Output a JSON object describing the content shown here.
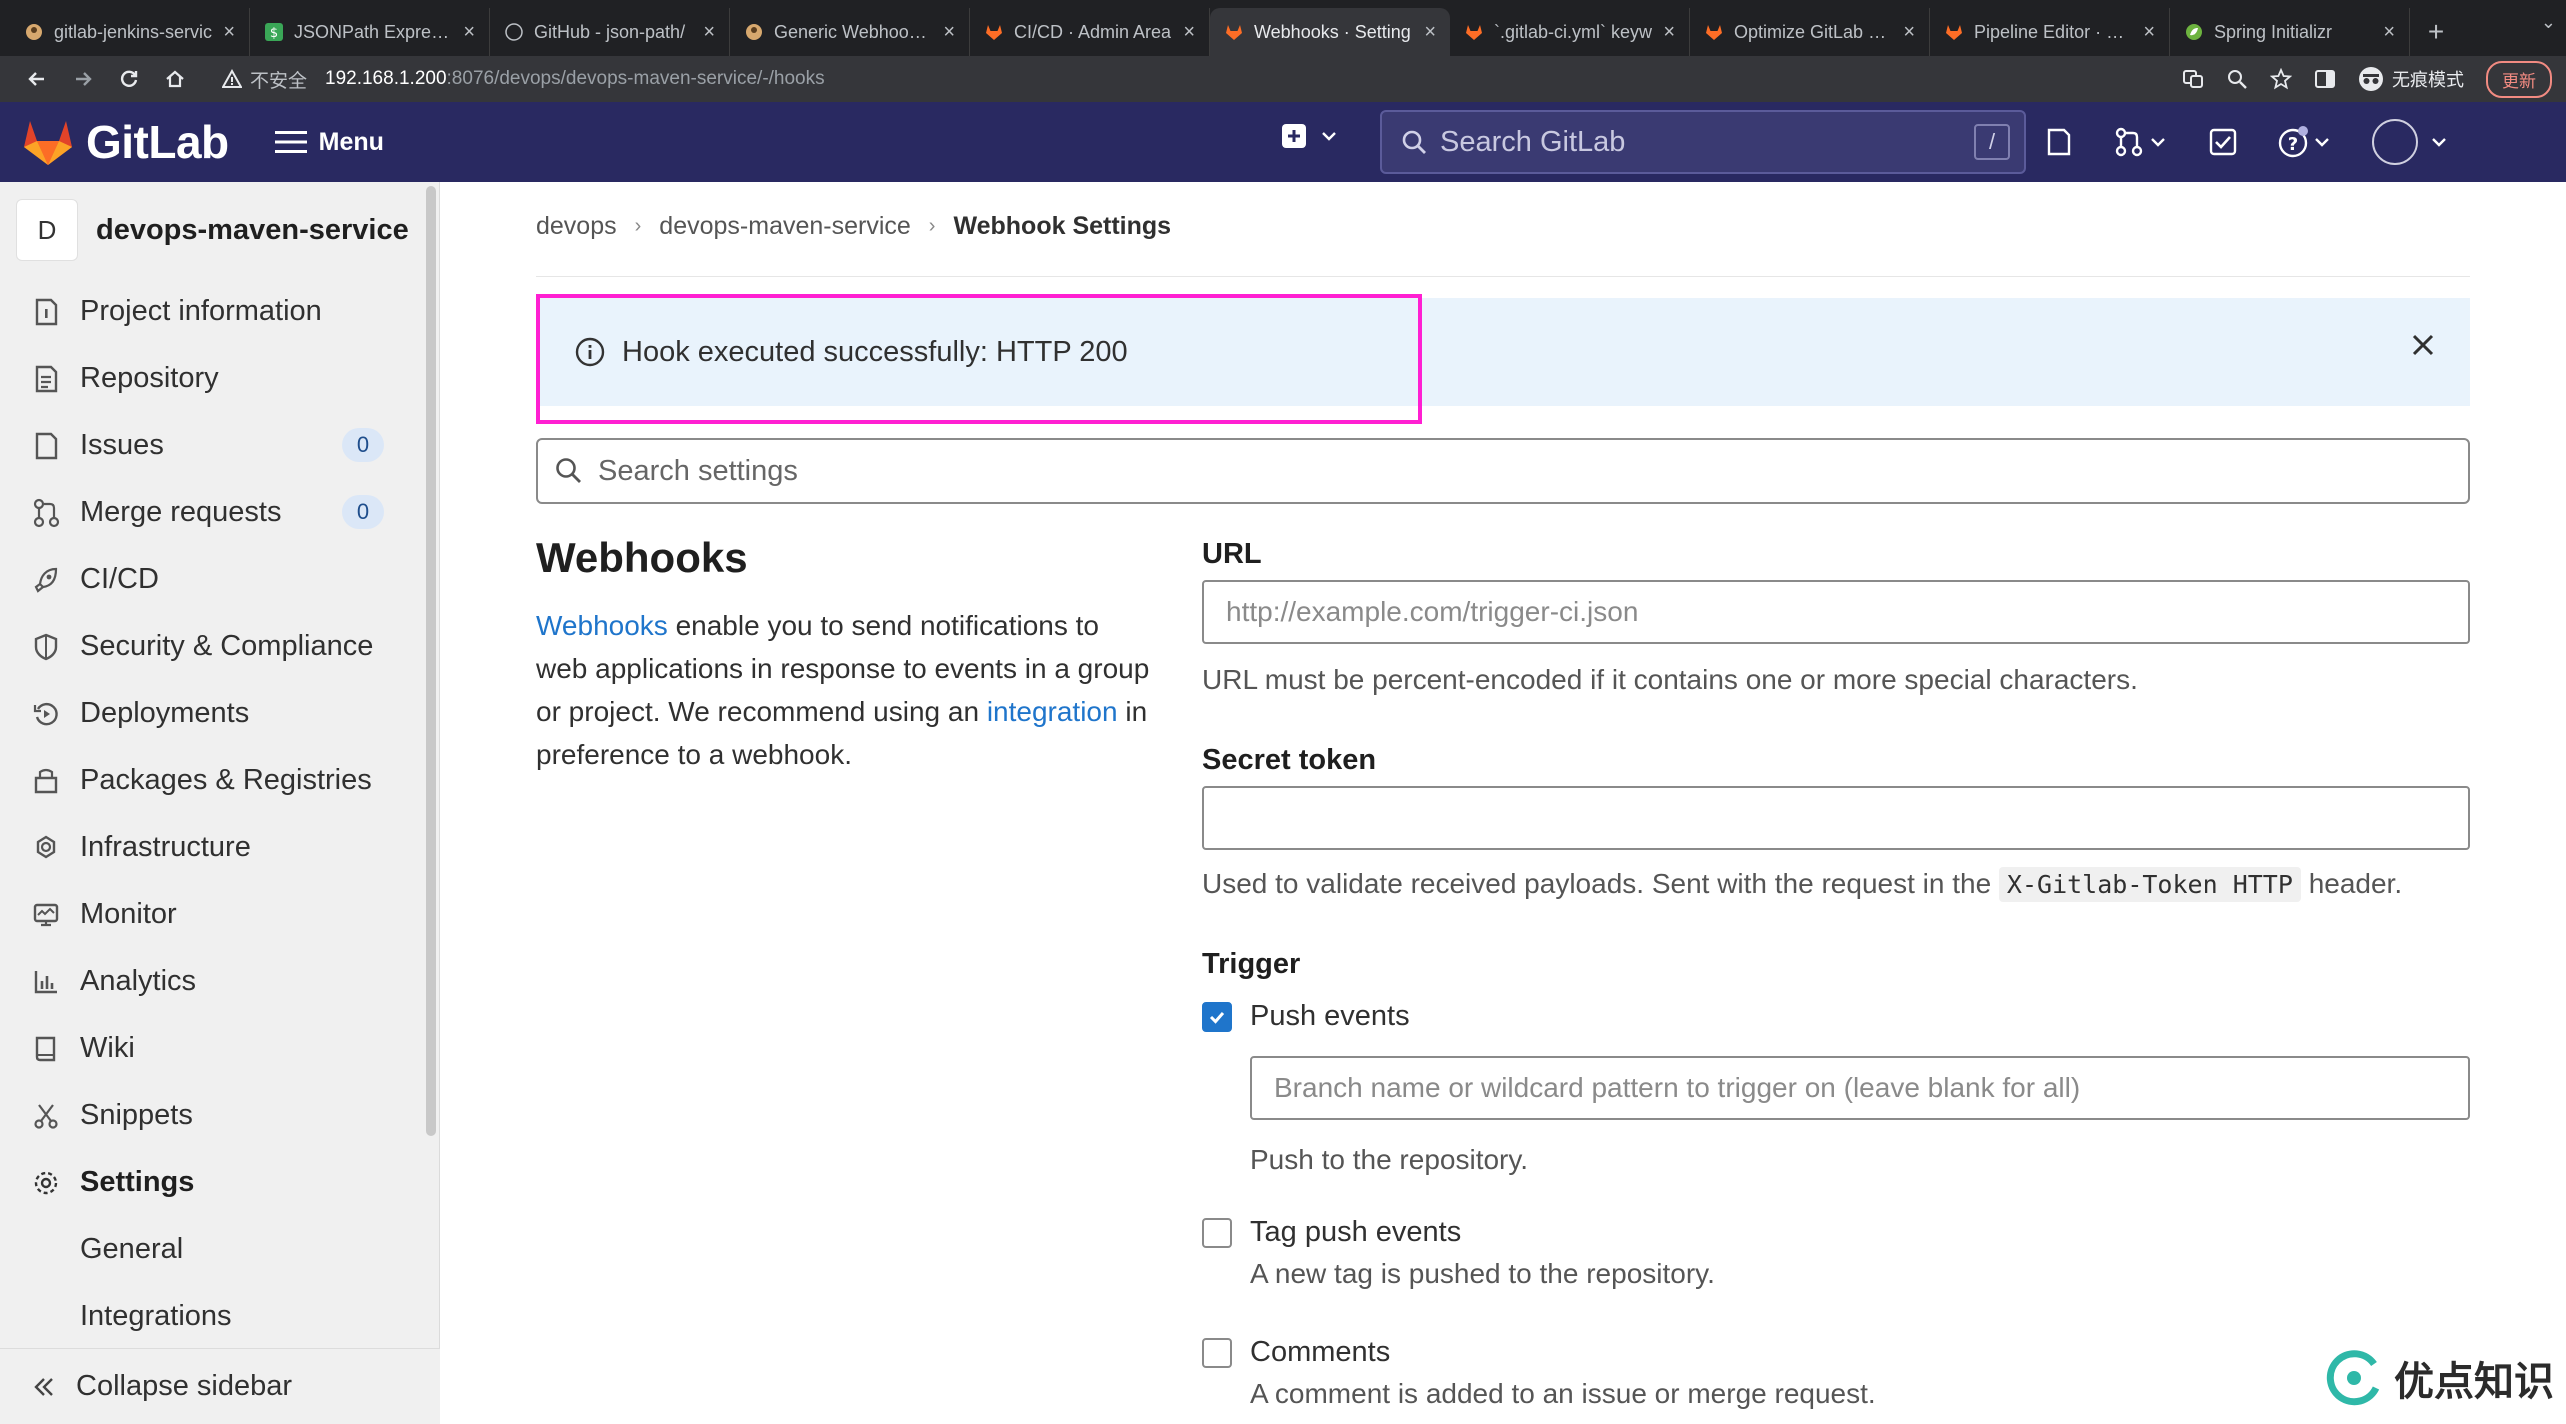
{
  "browser": {
    "tabs": [
      {
        "title": "gitlab-jenkins-servic",
        "active": false,
        "favicon": "bot-icon"
      },
      {
        "title": "JSONPath Expressio",
        "active": false,
        "favicon": "dollar-icon"
      },
      {
        "title": "GitHub - json-path/",
        "active": false,
        "favicon": "github-icon"
      },
      {
        "title": "Generic Webhook Tr",
        "active": false,
        "favicon": "bot-icon"
      },
      {
        "title": "CI/CD · Admin Area",
        "active": false,
        "favicon": "gitlab-icon"
      },
      {
        "title": "Webhooks · Setting",
        "active": true,
        "favicon": "gitlab-icon"
      },
      {
        "title": "`.gitlab-ci.yml` keyw",
        "active": false,
        "favicon": "gitlab-icon"
      },
      {
        "title": "Optimize GitLab CI/C",
        "active": false,
        "favicon": "gitlab-icon"
      },
      {
        "title": "Pipeline Editor · dev",
        "active": false,
        "favicon": "gitlab-icon"
      },
      {
        "title": "Spring Initializr",
        "active": false,
        "favicon": "spring-icon"
      }
    ],
    "tab_close": "×",
    "new_tab": "+",
    "insecure_label": "不安全",
    "url_host": "192.168.1.200",
    "url_path": ":8076/devops/devops-maven-service/-/hooks",
    "incognito_label": "无痕模式",
    "update_label": "更新"
  },
  "header": {
    "logo_text": "GitLab",
    "menu_label": "Menu",
    "search_placeholder": "Search GitLab",
    "search_shortcut": "/"
  },
  "sidebar": {
    "project_initial": "D",
    "project_name": "devops-maven-service",
    "items": [
      {
        "label": "Project information",
        "icon": "info-doc-icon"
      },
      {
        "label": "Repository",
        "icon": "doc-icon"
      },
      {
        "label": "Issues",
        "icon": "issues-icon",
        "count": "0"
      },
      {
        "label": "Merge requests",
        "icon": "merge-request-icon",
        "count": "0"
      },
      {
        "label": "CI/CD",
        "icon": "rocket-icon"
      },
      {
        "label": "Security & Compliance",
        "icon": "shield-icon"
      },
      {
        "label": "Deployments",
        "icon": "deployments-icon"
      },
      {
        "label": "Packages & Registries",
        "icon": "package-icon"
      },
      {
        "label": "Infrastructure",
        "icon": "cloud-gear-icon"
      },
      {
        "label": "Monitor",
        "icon": "monitor-icon"
      },
      {
        "label": "Analytics",
        "icon": "chart-icon"
      },
      {
        "label": "Wiki",
        "icon": "book-icon"
      },
      {
        "label": "Snippets",
        "icon": "scissors-icon"
      },
      {
        "label": "Settings",
        "icon": "gear-icon"
      }
    ],
    "sub_items": [
      "General",
      "Integrations"
    ],
    "collapse_label": "Collapse sidebar"
  },
  "breadcrumb": [
    "devops",
    "devops-maven-service",
    "Webhook Settings"
  ],
  "flash": {
    "message": "Hook executed successfully: HTTP 200"
  },
  "search_settings_placeholder": "Search settings",
  "webhooks": {
    "title": "Webhooks",
    "desc_link1": "Webhooks",
    "desc_part1": " enable you to send notifications to web applications in response to events in a group or project. We recommend using an ",
    "desc_link2": "integration",
    "desc_part2": " in preference to a webhook."
  },
  "form": {
    "url_label": "URL",
    "url_placeholder": "http://example.com/trigger-ci.json",
    "url_help": "URL must be percent-encoded if it contains one or more special characters.",
    "token_label": "Secret token",
    "token_value": "",
    "token_help_before": "Used to validate received payloads. Sent with the request in the",
    "token_help_code": "X-Gitlab-Token HTTP",
    "token_help_after": "header.",
    "trigger_label": "Trigger",
    "triggers": [
      {
        "label": "Push events",
        "checked": true,
        "help": "Push to the repository.",
        "branch_placeholder": "Branch name or wildcard pattern to trigger on (leave blank for all)"
      },
      {
        "label": "Tag push events",
        "checked": false,
        "help": "A new tag is pushed to the repository."
      },
      {
        "label": "Comments",
        "checked": false,
        "help": "A comment is added to an issue or merge request."
      }
    ]
  },
  "watermark": {
    "text": "优点知识"
  },
  "colors": {
    "header_bg": "#292961",
    "link": "#1f75cb",
    "flash_bg": "#e9f3fc",
    "highlight": "#ff1fd2"
  }
}
